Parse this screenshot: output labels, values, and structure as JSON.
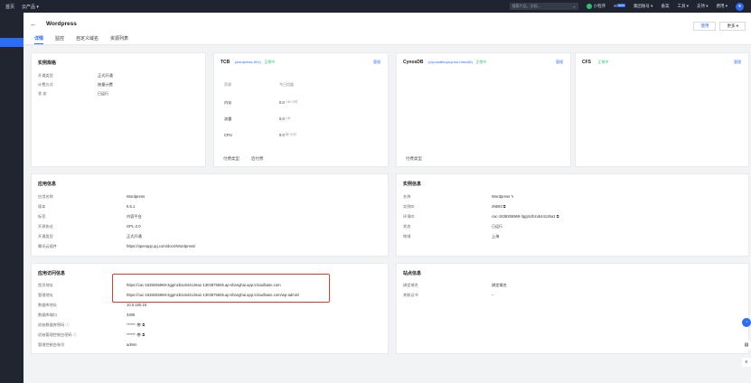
{
  "topbar": {
    "nav": [
      "首页",
      "云产品 ▾"
    ],
    "search_placeholder": "搜索产品、文档...",
    "right_items": [
      "小程序",
      "集团账号 ▾",
      "备案",
      "工具 ▾",
      "支持 ▾",
      "费用 ▾"
    ],
    "new_badge": "NEW"
  },
  "header": {
    "back_icon": "←",
    "title": "Wordpress",
    "tabs": [
      "详情",
      "监控",
      "自定义域名",
      "资源列表"
    ],
    "btn_use": "使用",
    "btn_more": "更多 ▾"
  },
  "spec": {
    "title": "实例规格",
    "rows": [
      {
        "k": "开通类型",
        "v": "正式开通"
      },
      {
        "k": "计费方式",
        "v": "按量计费"
      },
      {
        "k": "状  态",
        "v": "已运行"
      }
    ]
  },
  "tcb": {
    "title": "TCB",
    "env": "(wordpress-501)",
    "status": "正常中",
    "manage": "管理",
    "head": [
      "资源",
      "今日用量"
    ],
    "rows": [
      {
        "name": "内存",
        "value": "0.0",
        "unit": "GB*小时"
      },
      {
        "name": "流量",
        "value": "0.0",
        "unit": "GB"
      },
      {
        "name": "CPU",
        "value": "0.0",
        "unit": "核*小时"
      }
    ],
    "foot_label": "付费类型",
    "foot_value": "后付费"
  },
  "cynosdb": {
    "title": "CynosDB",
    "env": "(cynosdbmysql-ins-hfmx46)",
    "status": "正常中",
    "manage": "管理",
    "foot_label": "付费类型"
  },
  "cfs": {
    "title": "CFS",
    "status": "正常中",
    "manage": "管理"
  },
  "app_info": {
    "title": "应用信息",
    "rows": [
      {
        "k": "应用名称",
        "v": "Wordpress"
      },
      {
        "k": "版本",
        "v": "5.5.1"
      },
      {
        "k": "标签",
        "v": "内容平台"
      },
      {
        "k": "开源协议",
        "v": "GPL-2.0"
      },
      {
        "k": "开通类型",
        "v": "正式开通"
      },
      {
        "k": "腾讯云插件",
        "v": "https://openapp.qq.com/docs/Wordpress/"
      }
    ]
  },
  "instance_info": {
    "title": "实例信息",
    "rows": [
      {
        "k": "名称",
        "v": "Wordpress ✎"
      },
      {
        "k": "实例ID",
        "v": "26693 ⧉"
      },
      {
        "k": "环境ID",
        "v": "cac-1638255969-3ggmzbzu544126a1 ⧉"
      },
      {
        "k": "状态",
        "v": "已运行"
      },
      {
        "k": "地域",
        "v": "上海"
      }
    ]
  },
  "access_info": {
    "title": "应用访问信息",
    "rows": [
      {
        "k": "首页地址",
        "v": "https://cac-1638255969-3ggmzbzu544126a1-1303875605.ap-shanghai.app.tcloudbase.com"
      },
      {
        "k": "管理地址",
        "v": "https://cac-1638255969-3ggmzbzu544126a1-1303875605.ap-shanghai.app.tcloudbase.com/wp-admin/"
      },
      {
        "k": "数据库地址",
        "v": "10.0.150.15"
      },
      {
        "k": "数据库端口",
        "v": "3306"
      },
      {
        "k": "初始数据库密码 ⓘ",
        "v": "****** 👁 ⧉"
      },
      {
        "k": "初始管理控制台密码 ⓘ",
        "v": "****** 👁 ⧉"
      },
      {
        "k": "管理控制台账号",
        "v": "admin"
      }
    ]
  },
  "site_info": {
    "title": "站点信息",
    "rows": [
      {
        "k": "绑定域名",
        "v": "绑定域名"
      },
      {
        "k": "关联证书",
        "v": "--"
      }
    ]
  }
}
